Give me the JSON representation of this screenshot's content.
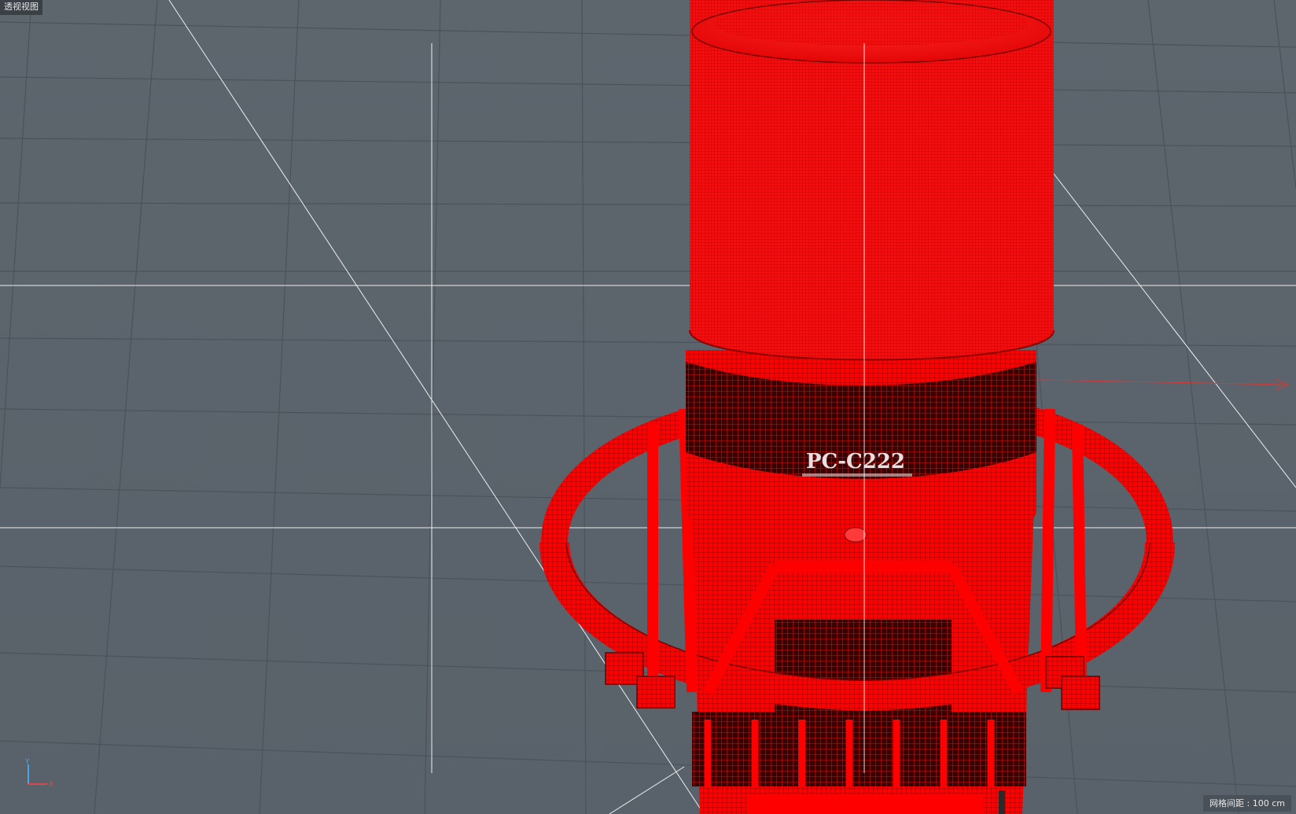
{
  "viewport": {
    "label": "透视视图",
    "grid_spacing_label": "网格间距 : 100 cm",
    "background_color": "#5a626a",
    "grid_color": "#4b525a",
    "guide_line_color": "#ffffff",
    "model_color": "#ff0000"
  },
  "model": {
    "brand_text": "PC-C222",
    "wireframe": true
  },
  "axis_gizmo": {
    "y_label": "Y",
    "x_label": "X"
  }
}
